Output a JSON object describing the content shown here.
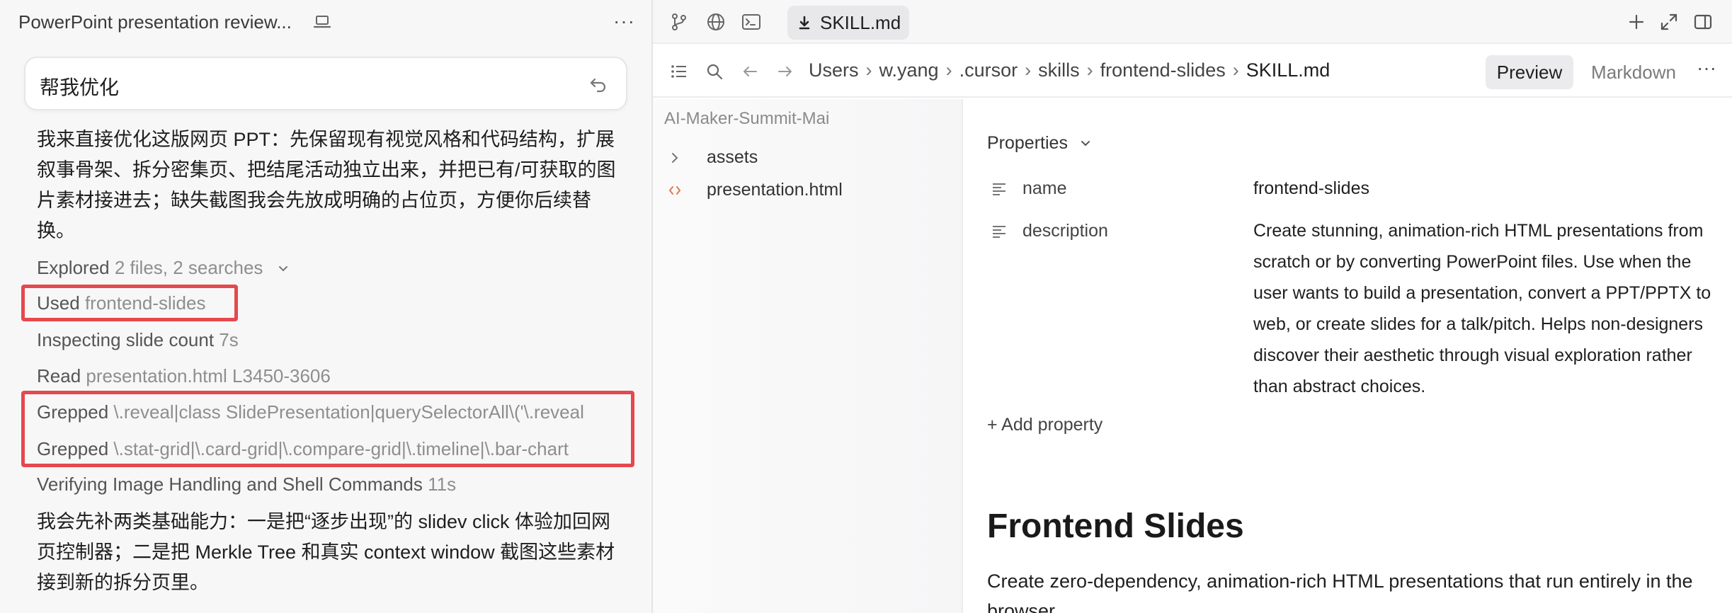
{
  "chat": {
    "title": "PowerPoint presentation review...",
    "more_label": "···",
    "prompt": "帮我优化",
    "intro_message": "我来直接优化这版网页 PPT：先保留现有视觉风格和代码结构，扩展叙事骨架、拆分密集页、把结尾活动独立出来，并把已有/可获取的图片素材接进去；缺失截图我会先放成明确的占位页，方便你后续替换。",
    "steps": {
      "explored": {
        "verb": "Explored",
        "detail": "2 files, 2 searches"
      },
      "used": {
        "verb": "Used",
        "detail": "frontend-slides"
      },
      "inspecting": {
        "verb": "Inspecting slide count",
        "detail": "7s"
      },
      "read": {
        "verb": "Read",
        "detail": "presentation.html L3450-3606"
      },
      "grep1": {
        "verb": "Grepped",
        "detail": "\\.reveal|class SlidePresentation|querySelectorAll\\('\\.reveal"
      },
      "grep2": {
        "verb": "Grepped",
        "detail": "\\.stat-grid|\\.card-grid|\\.compare-grid|\\.timeline|\\.bar-chart"
      },
      "verifying": {
        "verb": "Verifying Image Handling and Shell Commands",
        "detail": "11s"
      }
    },
    "followup_message": "我会先补两类基础能力：一是把“逐步出现”的 slidev click 体验加回网页控制器；二是把 Merkle Tree 和真实 context window 截图这些素材接到新的拆分页里。",
    "highlight_color": "#e5484d"
  },
  "editor": {
    "tab_label": "SKILL.md",
    "breadcrumb": [
      "Users",
      "w.yang",
      ".cursor",
      "skills",
      "frontend-slides",
      "SKILL.md"
    ],
    "preview_label": "Preview",
    "markdown_label": "Markdown",
    "more_label": "···",
    "tree": {
      "root": "AI-Maker-Summit-Mai",
      "items": [
        {
          "label": "assets",
          "icon": "chevron-right-icon"
        },
        {
          "label": "presentation.html",
          "icon": "code-icon"
        }
      ]
    },
    "properties": {
      "header": "Properties",
      "rows": [
        {
          "key": "name",
          "value": "frontend-slides"
        },
        {
          "key": "description",
          "value": "Create stunning, animation-rich HTML presentations from scratch or by converting PowerPoint files. Use when the user wants to build a presentation, convert a PPT/PPTX to web, or create slides for a talk/pitch. Helps non-designers discover their aesthetic through visual exploration rather than abstract choices."
        }
      ],
      "add_label": "+ Add property"
    },
    "heading": "Frontend Slides",
    "paragraph": "Create zero-dependency, animation-rich HTML presentations that run entirely in the browser."
  }
}
